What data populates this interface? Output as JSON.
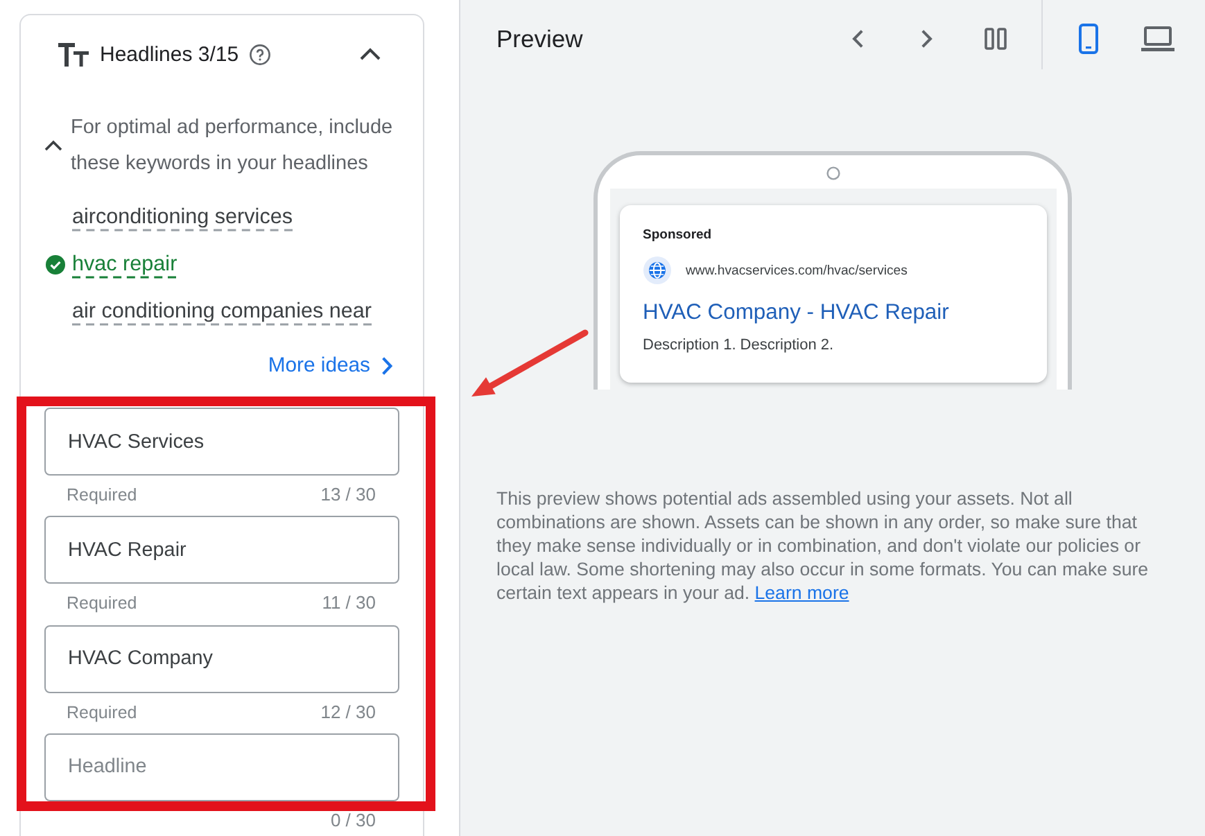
{
  "headlines_panel": {
    "title": "Headlines 3/15",
    "expanded": true,
    "keyword_hint": {
      "text": "For optimal ad performance, include these keywords in your headlines",
      "expanded": true
    },
    "keywords": [
      {
        "text": "airconditioning services",
        "used": false
      },
      {
        "text": "hvac repair",
        "used": true
      },
      {
        "text": "air conditioning companies near",
        "used": false
      }
    ],
    "more_ideas": "More ideas",
    "fields": [
      {
        "value": "HVAC Services",
        "helper": "Required",
        "counter": "13 / 30"
      },
      {
        "value": "HVAC Repair",
        "helper": "Required",
        "counter": "11 / 30"
      },
      {
        "value": "HVAC Company",
        "helper": "Required",
        "counter": "12 / 30"
      },
      {
        "placeholder": "Headline",
        "counter": "0 / 30"
      }
    ]
  },
  "preview": {
    "title": "Preview",
    "device_options": [
      {
        "kind": "mobile",
        "selected": true
      },
      {
        "kind": "desktop",
        "selected": false
      }
    ],
    "ad": {
      "label": "Sponsored",
      "url": "www.hvacservices.com/hvac/services",
      "headline": "HVAC Company - HVAC Repair",
      "description": "Description 1. Description 2."
    },
    "disclaimer": {
      "text": "This preview shows potential ads assembled using your assets. Not all combinations are shown. Assets can be shown in any order, so make sure that they make sense individually or in combination, and don't violate our policies or local law. Some shortening may also occur in some formats. You can make sure certain text appears in your ad.",
      "link": "Learn more"
    }
  }
}
